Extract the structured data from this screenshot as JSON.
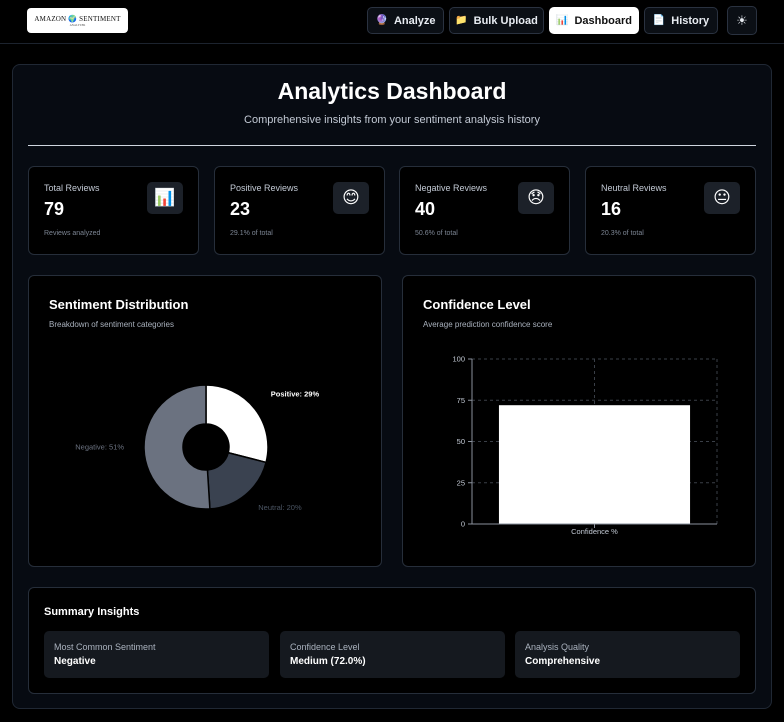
{
  "header": {
    "logo_text": "AMAZON 🌍 SENTIMENT",
    "logo_sub": "ANALYZER",
    "nav": [
      {
        "label": "Analyze",
        "icon": "🔮"
      },
      {
        "label": "Bulk Upload",
        "icon": "📁"
      },
      {
        "label": "Dashboard",
        "icon": "📊"
      },
      {
        "label": "History",
        "icon": "📄"
      }
    ],
    "theme_icon": "☀"
  },
  "page": {
    "title": "Analytics Dashboard",
    "subtitle": "Comprehensive insights from your sentiment analysis history"
  },
  "stats": [
    {
      "label": "Total Reviews",
      "value": "79",
      "note": "Reviews analyzed",
      "icon": "📊"
    },
    {
      "label": "Positive Reviews",
      "value": "23",
      "note": "29.1% of total",
      "icon": "😊"
    },
    {
      "label": "Negative Reviews",
      "value": "40",
      "note": "50.6% of total",
      "icon": "😞"
    },
    {
      "label": "Neutral Reviews",
      "value": "16",
      "note": "20.3% of total",
      "icon": "😐"
    }
  ],
  "distribution": {
    "title": "Sentiment Distribution",
    "subtitle": "Breakdown of sentiment categories"
  },
  "confidence": {
    "title": "Confidence Level",
    "subtitle": "Average prediction confidence score"
  },
  "chart_data": [
    {
      "type": "pie",
      "title": "Sentiment Distribution",
      "slices": [
        {
          "name": "Positive",
          "value": 29,
          "label": "Positive: 29%",
          "color": "#ffffff"
        },
        {
          "name": "Neutral",
          "value": 20,
          "label": "Neutral: 20%",
          "color": "#3a4250"
        },
        {
          "name": "Negative",
          "value": 51,
          "label": "Negative: 51%",
          "color": "#6b7280"
        }
      ]
    },
    {
      "type": "bar",
      "title": "Confidence Level",
      "categories": [
        "Confidence %"
      ],
      "values": [
        72
      ],
      "ylim": [
        0,
        100
      ],
      "yticks": [
        "0",
        "25",
        "50",
        "75",
        "100"
      ],
      "grid": true,
      "color": "#ffffff"
    }
  ],
  "summary": {
    "title": "Summary Insights",
    "items": [
      {
        "label": "Most Common Sentiment",
        "value": "Negative"
      },
      {
        "label": "Confidence Level",
        "value": "Medium (72.0%)"
      },
      {
        "label": "Analysis Quality",
        "value": "Comprehensive"
      }
    ]
  }
}
